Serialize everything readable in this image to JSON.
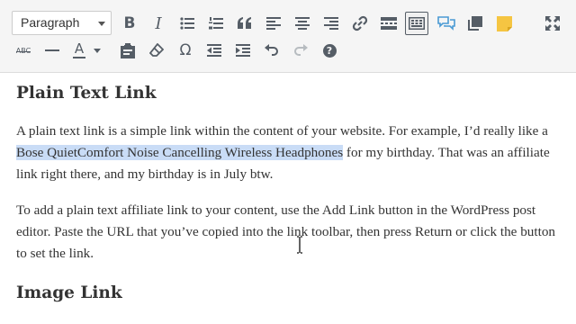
{
  "toolbar": {
    "format_value": "Paragraph",
    "row1_icons": [
      "bold-icon",
      "italic-icon",
      "bullet-list-icon",
      "numbered-list-icon",
      "blockquote-icon",
      "align-left-icon",
      "align-center-icon",
      "align-right-icon",
      "link-icon",
      "read-more-icon",
      "toolbar-toggle-icon",
      "comment-bubbles-icon",
      "copy-icon",
      "sticky-note-icon"
    ],
    "row2_icons": [
      "strikethrough-icon",
      "horizontal-line-icon",
      "text-color-icon",
      "paste-as-text-icon",
      "clear-formatting-icon",
      "special-character-icon",
      "outdent-icon",
      "indent-icon",
      "undo-icon",
      "redo-icon",
      "help-icon"
    ],
    "fullscreen_icon": "fullscreen-icon",
    "strike_label": "ABC",
    "text_color_label": "A",
    "bold_label": "B",
    "italic_label": "I",
    "help_label": "?",
    "omega_label": "Ω",
    "accent_color": "#c9dcf6",
    "sticky_color": "#f5c542"
  },
  "content": {
    "heading1": "Plain Text Link",
    "p1_before": "A plain text link is a simple link within the content of your website. For example, I’d really like a ",
    "p1_selected": "Bose QuietComfort Noise Cancelling Wireless Headphones",
    "p1_after": " for my birthday. That was an affiliate link right there, and my birthday is in July btw.",
    "p2": "To add a plain text affiliate link to your content, use the Add Link button in the WordPress post editor. Paste the URL that you’ve copied into the link toolbar, then press Return or click the button to set the link.",
    "heading2": "Image Link"
  }
}
